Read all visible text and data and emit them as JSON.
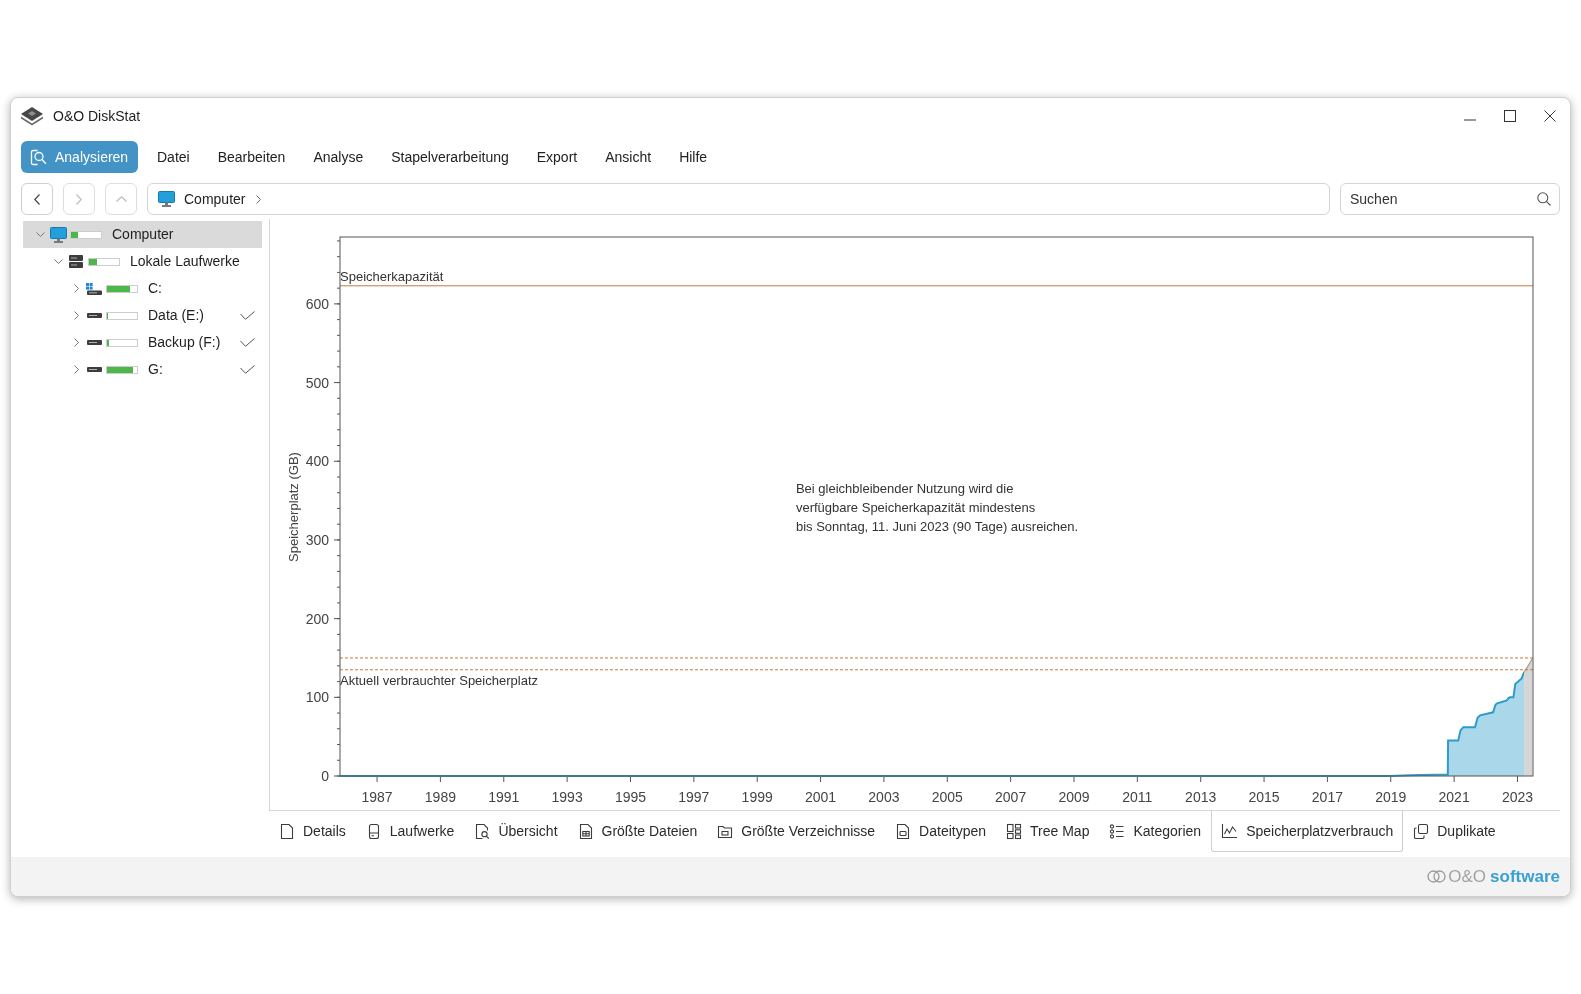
{
  "window": {
    "title": "O&O DiskStat"
  },
  "toolbar": {
    "primary_button": {
      "label": "Analysieren"
    },
    "menu": [
      "Datei",
      "Bearbeiten",
      "Analyse",
      "Stapelverarbeitung",
      "Export",
      "Ansicht",
      "Hilfe"
    ]
  },
  "navigation": {
    "buttons": [
      {
        "kind": "back",
        "disabled": false
      },
      {
        "kind": "forward",
        "disabled": true
      },
      {
        "kind": "up",
        "disabled": true
      }
    ],
    "breadcrumb": [
      {
        "kind": "computer",
        "label": "Computer"
      }
    ],
    "search": {
      "placeholder": "Suchen"
    }
  },
  "tree": [
    {
      "label": "Computer",
      "kind": "computer",
      "expanded": true,
      "selected": true,
      "level": 0.22,
      "children": [
        {
          "label": "Lokale Laufwerke",
          "kind": "drive-group",
          "expanded": true,
          "selected": false,
          "level": 0.28,
          "children": [
            {
              "label": "C:",
              "kind": "system-drive",
              "expanded": false,
              "selected": false,
              "checked": false,
              "level": 0.76
            },
            {
              "label": "Data (E:)",
              "kind": "drive",
              "expanded": false,
              "selected": false,
              "checked": true,
              "level": 0.03
            },
            {
              "label": "Backup (F:)",
              "kind": "drive",
              "expanded": false,
              "selected": false,
              "checked": true,
              "level": 0.07
            },
            {
              "label": "G:",
              "kind": "drive",
              "expanded": false,
              "selected": false,
              "checked": true,
              "level": 0.85
            }
          ]
        }
      ]
    }
  ],
  "chart": {
    "chart_data": {
      "type": "area",
      "ylabel": "Speicherplatz (GB)",
      "x": [
        1985.83,
        2019.0,
        2019.6,
        2020.8,
        2020.81,
        2021.13,
        2021.2,
        2021.29,
        2021.66,
        2021.74,
        2021.82,
        2022.23,
        2022.3,
        2022.34,
        2022.66,
        2022.72,
        2022.76,
        2022.87,
        2022.93,
        2023.13,
        2023.21,
        2023.47
      ],
      "series": [
        {
          "color": "#2c9ccb",
          "values": [
            0,
            0,
            1,
            2,
            45,
            45,
            58,
            62,
            62,
            74,
            77,
            81,
            90,
            92,
            96,
            99,
            100,
            100,
            117,
            124,
            132,
            null
          ]
        },
        {
          "color": "#d6d6d6",
          "values": [
            null,
            null,
            null,
            null,
            null,
            null,
            null,
            null,
            null,
            null,
            null,
            null,
            null,
            null,
            null,
            null,
            null,
            null,
            null,
            null,
            132,
            149
          ]
        }
      ],
      "xlim": [
        1985.83,
        2023.49
      ],
      "ylim": [
        0,
        685
      ],
      "xticks": [
        1987,
        1989,
        1991,
        1993,
        1995,
        1997,
        1999,
        2001,
        2003,
        2005,
        2007,
        2009,
        2011,
        2013,
        2015,
        2017,
        2019,
        2021,
        2023
      ],
      "yticks": [
        0,
        100,
        200,
        300,
        400,
        500,
        600
      ],
      "ref_lines": [
        {
          "axis": "y",
          "value": 623,
          "label": "Speicherkapazität"
        },
        {
          "axis": "y",
          "value": 150
        },
        {
          "axis": "y",
          "value": 135,
          "label": "Aktuell verbrauchter Speicherplatz"
        }
      ],
      "annotations": [
        "Bei gleichbleibender Nutzung wird die\nverfügbare Speicherkapazität mindestens\nbis Sonntag, 11. Juni 2023 (90 Tage) ausreichen."
      ]
    }
  },
  "tabs": [
    {
      "label": "Details",
      "selected": false
    },
    {
      "label": "Laufwerke",
      "selected": false
    },
    {
      "label": "Übersicht",
      "selected": false
    },
    {
      "label": "Größte Dateien",
      "selected": false
    },
    {
      "label": "Größte Verzeichnisse",
      "selected": false
    },
    {
      "label": "Dateitypen",
      "selected": false
    },
    {
      "label": "Tree Map",
      "selected": false
    },
    {
      "label": "Kategorien",
      "selected": false
    },
    {
      "label": "Speicherplatzverbrauch",
      "selected": true
    },
    {
      "label": "Duplikate",
      "selected": false
    }
  ],
  "footer": {
    "logo": {
      "prefix": "O&O",
      "name": "software"
    }
  }
}
